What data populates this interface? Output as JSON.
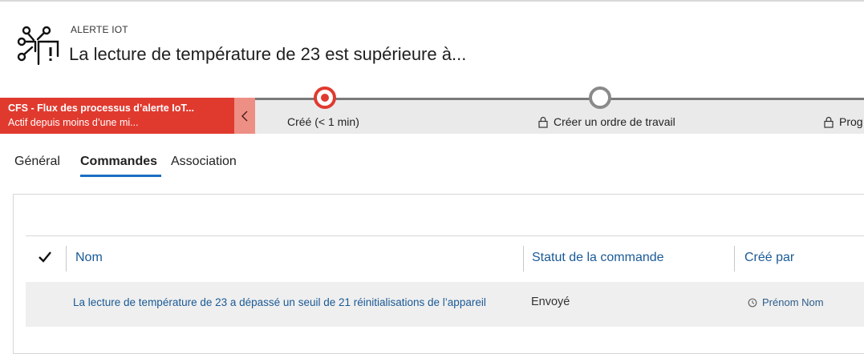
{
  "header": {
    "kicker": "ALERTE IOT",
    "title": "La lecture de température de 23 est supérieure à...",
    "icon": "iot-alert-icon"
  },
  "bpf": {
    "process_name": "CFS - Flux des processus d’alerte IoT...",
    "process_status": "Actif depuis moins d’une mi...",
    "collapse_icon": "chevron-left-icon",
    "stages": [
      {
        "label": "Créé (< 1 min)",
        "state": "active",
        "locked": false
      },
      {
        "label": "Créer un ordre de travail",
        "state": "next",
        "locked": true
      },
      {
        "label": "Prog",
        "state": "upcoming",
        "locked": true
      }
    ],
    "accent_color": "#e03a2f"
  },
  "tabs": [
    {
      "label": "Général",
      "active": false
    },
    {
      "label": "Commandes",
      "active": true
    },
    {
      "label": "Association",
      "active": false
    }
  ],
  "grid": {
    "select_all_icon": "checkmark-icon",
    "columns": [
      "Nom",
      "Statut de la commande",
      "Créé par"
    ],
    "rows": [
      {
        "name": "La lecture de température de 23 a dépassé un seuil de 21 réinitialisations de l’appareil",
        "status": "Envoyé",
        "created_by": "Prénom Nom",
        "owner_icon": "clock-icon"
      }
    ]
  }
}
